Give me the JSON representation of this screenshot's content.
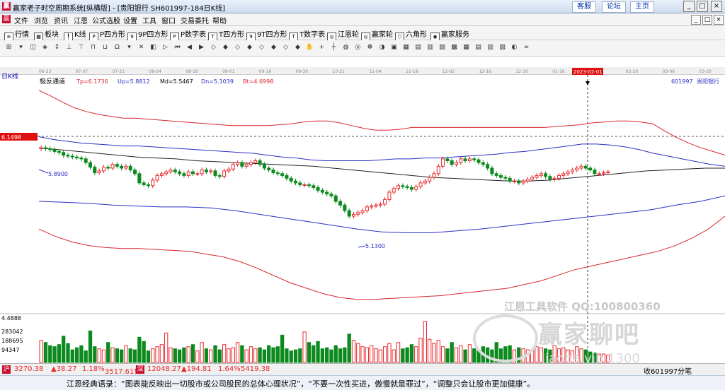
{
  "titlebar": {
    "app_icon": "赢",
    "title": "赢家老子时空周期系统[纵横版] - [贵阳银行  SH601997-184日K线]",
    "links": [
      "客服",
      "论坛",
      "主页"
    ],
    "win_buttons": [
      "_",
      "□",
      "×"
    ]
  },
  "menubar": {
    "items": [
      "文件",
      "浏览",
      "资讯",
      "江恩",
      "公式选股",
      "设置",
      "工具",
      "窗口",
      "交易委托",
      "帮助"
    ],
    "mdi_buttons": [
      "_",
      "□",
      "×"
    ]
  },
  "toolbar1": {
    "items": [
      "行情",
      "板块",
      "K线",
      "P四方形",
      "9P四方形",
      "P数字表",
      "T四方形",
      "9T四方形",
      "T数字表",
      "江恩轮",
      "赢家轮",
      "六角形",
      "赢家服务"
    ]
  },
  "toolbar2": {
    "icon_glyphs": [
      "⊞",
      "▾",
      "◫",
      "◈",
      "↕",
      "⊥",
      "⊤",
      "⊓",
      "⊔",
      "Ω",
      "▾",
      "✕",
      "◧",
      "▷",
      "⏮",
      "◀",
      "▶",
      "◇",
      "◆",
      "◇",
      "◆",
      "◇",
      "◆",
      "◇",
      "◆",
      "✋",
      "+",
      "┼",
      "◍",
      "◎",
      "☸",
      "◑",
      "▣",
      "▦",
      "▤",
      "▥",
      "▨",
      "▩",
      "▦",
      "▤",
      "▥",
      "▧",
      "◐",
      "∞"
    ]
  },
  "chart_header": {
    "period": "日K线",
    "indicator": "极反通道",
    "tp": "Tp=6.1736",
    "up": "Up=5.8812",
    "md": "Md=5.5467",
    "dn": "Dn=5.1039",
    "bt": "Bt=4.6998",
    "code": "601997",
    "name": "贵阳银行",
    "price_cursor": "6.1498",
    "date_cursor": "2023-02-01",
    "hi_label": "5.8900",
    "lo_label": "5.1300"
  },
  "date_axis": [
    "06-23",
    "07-07",
    "07-21",
    "08-04",
    "08-18",
    "09-01",
    "09-16",
    "09-30",
    "10-21",
    "11-04",
    "11-18",
    "12-02",
    "12-16",
    "12-30",
    "01-16",
    "",
    "02-20",
    "03-06",
    "03-20"
  ],
  "volume_axis": [
    "4.4888",
    "283042",
    "188695",
    "94347"
  ],
  "statusbar": {
    "sh_icon": "沪",
    "sh_index": "3270.38",
    "sh_change": "▲38.27",
    "sh_pct": "1.18%",
    "sh_amount": "3517.61亿",
    "sz_icon": "深",
    "sz_index": "12048.27",
    "sz_change": "▲194.81",
    "sz_pct": "1.64%",
    "sz_amount": "5419.38",
    "right": "收601997分笔"
  },
  "quote": "江恩经典语录：“图表能反映出一切股市或公司股民的总体心理状况”，“不要一次性买进，傲慢就是罪过”，“调整只会让股市更加健康”。",
  "watermark": {
    "line1": "江恩工具软件  QQ:100800360",
    "line2": "赢家聊吧",
    "line3": "liaoba.vip 1300"
  },
  "colors": {
    "up": "#e8292f",
    "down": "#0c8a1e",
    "band_outer": "#d8262c",
    "band_inner": "#2b2fc4",
    "mid": "#222222",
    "cursor_bg": "#e01010"
  },
  "chart_data": {
    "type": "candlestick",
    "price_range": [
      4.1,
      6.6
    ],
    "price_series": [
      5.88,
      5.87,
      5.86,
      5.84,
      5.83,
      5.8,
      5.79,
      5.78,
      5.77,
      5.76,
      5.72,
      5.67,
      5.61,
      5.63,
      5.67,
      5.66,
      5.7,
      5.68,
      5.66,
      5.68,
      5.64,
      5.6,
      5.5,
      5.48,
      5.47,
      5.53,
      5.58,
      5.6,
      5.62,
      5.64,
      5.62,
      5.6,
      5.58,
      5.62,
      5.6,
      5.6,
      5.64,
      5.62,
      5.63,
      5.58,
      5.57,
      5.63,
      5.65,
      5.7,
      5.72,
      5.68,
      5.7,
      5.72,
      5.74,
      5.7,
      5.66,
      5.64,
      5.61,
      5.6,
      5.58,
      5.55,
      5.52,
      5.5,
      5.48,
      5.48,
      5.47,
      5.45,
      5.42,
      5.4,
      5.38,
      5.36,
      5.3,
      5.26,
      5.2,
      5.14,
      5.16,
      5.18,
      5.2,
      5.24,
      5.25,
      5.26,
      5.27,
      5.32,
      5.4,
      5.44,
      5.47,
      5.46,
      5.45,
      5.43,
      5.46,
      5.5,
      5.52,
      5.56,
      5.6,
      5.68,
      5.76,
      5.74,
      5.7,
      5.72,
      5.76,
      5.74,
      5.76,
      5.75,
      5.72,
      5.7,
      5.66,
      5.6,
      5.58,
      5.56,
      5.55,
      5.52,
      5.52,
      5.5,
      5.52,
      5.54,
      5.56,
      5.58,
      5.6,
      5.57,
      5.54,
      5.55,
      5.58,
      5.6,
      5.62,
      5.64,
      5.66,
      5.68,
      5.66,
      5.64,
      5.6,
      5.6,
      5.61,
      5.62
    ],
    "tp_band": [
      6.5,
      6.44,
      6.37,
      6.31,
      6.27,
      6.24,
      6.22,
      6.2,
      6.2,
      6.19,
      6.18,
      6.17,
      6.16,
      6.15,
      6.14,
      6.13,
      6.12,
      6.12,
      6.12,
      6.12,
      6.13,
      6.14,
      6.16,
      6.17,
      6.17,
      6.15,
      6.12,
      6.09,
      6.07,
      6.07,
      6.08,
      6.1,
      6.1,
      6.1,
      6.1,
      6.1,
      6.1,
      6.1,
      6.1,
      6.1,
      6.1,
      6.1,
      6.1,
      6.11,
      6.12,
      6.13,
      6.15,
      6.16,
      6.17,
      6.17,
      6.16,
      6.14,
      6.06,
      5.99,
      5.93,
      5.88,
      5.84,
      5.8
    ],
    "up_band": [
      6.0,
      5.97,
      5.95,
      5.93,
      5.92,
      5.91,
      5.9,
      5.9,
      5.89,
      5.88,
      5.87,
      5.86,
      5.85,
      5.84,
      5.83,
      5.82,
      5.8,
      5.78,
      5.77,
      5.75,
      5.74,
      5.74,
      5.74,
      5.74,
      5.75,
      5.76,
      5.76,
      5.77,
      5.77,
      5.78,
      5.79,
      5.8,
      5.81,
      5.83,
      5.84,
      5.86,
      5.88,
      5.9,
      5.92,
      5.92,
      5.91,
      5.89,
      5.86,
      5.82,
      5.79,
      5.76,
      5.73,
      5.7,
      5.68
    ],
    "md_line": [
      5.88,
      5.86,
      5.84,
      5.82,
      5.8,
      5.78,
      5.77,
      5.76,
      5.74,
      5.73,
      5.72,
      5.71,
      5.7,
      5.69,
      5.68,
      5.66,
      5.64,
      5.62,
      5.6,
      5.58,
      5.56,
      5.55,
      5.54,
      5.53,
      5.52,
      5.52,
      5.53,
      5.55,
      5.57,
      5.59,
      5.61,
      5.63,
      5.64,
      5.65,
      5.66,
      5.66
    ],
    "dn_band": [
      5.3,
      5.29,
      5.28,
      5.26,
      5.25,
      5.24,
      5.24,
      5.23,
      5.2,
      5.16,
      5.12,
      5.08,
      5.04,
      5.0,
      4.97,
      4.96,
      4.96,
      4.98,
      5.0,
      5.03,
      5.06,
      5.09,
      5.12,
      5.15,
      5.18,
      5.21,
      5.26,
      5.3,
      5.36
    ],
    "bt_band": [
      5.0,
      4.92,
      4.86,
      4.82,
      4.8,
      4.79,
      4.79,
      4.78,
      4.77,
      4.76,
      4.73,
      4.7,
      4.65,
      4.58,
      4.5,
      4.42,
      4.36,
      4.3,
      4.26,
      4.24,
      4.24,
      4.25,
      4.26,
      4.27,
      4.28,
      4.3,
      4.32,
      4.34,
      4.36,
      4.4,
      4.44,
      4.5,
      4.56,
      4.6,
      4.64,
      4.68,
      4.72,
      4.76,
      4.82,
      4.9,
      5.0,
      5.14
    ],
    "volumes": [
      2.1,
      1.9,
      1.6,
      1.5,
      1.7,
      2.5,
      1.8,
      1.2,
      1.4,
      1.6,
      1.1,
      3.0,
      1.5,
      1.3,
      1.2,
      1.9,
      1.4,
      1.3,
      1.2,
      1.6,
      1.3,
      1.2,
      2.4,
      2.0,
      1.1,
      1.3,
      1.5,
      1.7,
      2.8,
      1.4,
      1.3,
      1.2,
      1.4,
      1.5,
      1.7,
      1.1,
      1.9,
      1.3,
      1.2,
      1.6,
      1.2,
      1.7,
      1.3,
      1.4,
      1.9,
      1.6,
      1.2,
      1.5,
      1.3,
      1.4,
      1.2,
      1.6,
      1.4,
      1.5,
      2.6,
      1.3,
      1.1,
      1.2,
      1.3,
      2.9,
      1.9,
      1.6,
      2.0,
      1.3,
      1.4,
      1.2,
      1.6,
      1.3,
      1.4,
      2.7,
      2.1,
      1.8,
      1.5,
      1.4,
      1.6,
      1.3,
      1.2,
      1.5,
      1.8,
      1.2,
      1.9,
      1.3,
      1.4,
      1.7,
      1.5,
      2.3,
      3.9,
      2.2,
      1.8,
      2.1,
      1.5,
      1.3,
      1.9,
      1.4,
      1.6,
      1.2,
      1.7,
      1.3,
      1.1,
      1.5,
      1.4,
      1.2,
      1.9,
      1.3,
      1.5,
      1.6,
      1.2,
      1.4,
      1.3,
      1.2,
      1.1,
      1.5,
      1.4,
      1.3,
      1.2,
      1.6,
      1.3,
      1.4,
      1.2,
      1.1,
      1.5,
      1.3,
      1.2,
      1.0,
      0.9,
      0.8,
      0.8,
      0.7
    ]
  }
}
